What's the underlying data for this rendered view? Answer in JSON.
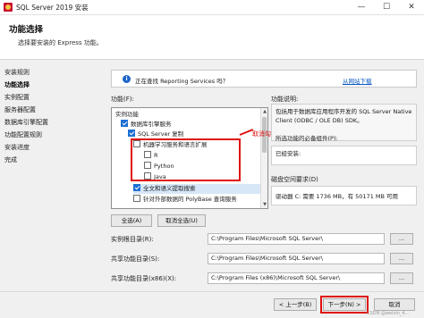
{
  "window": {
    "title": "SQL Server 2019 安装",
    "min_glyph": "—",
    "max_glyph": "☐",
    "close_glyph": "✕"
  },
  "header": {
    "title": "功能选择",
    "subtitle": "选择要安装的 Express 功能。"
  },
  "nav": {
    "items": [
      "安装规则",
      "功能选择",
      "实例配置",
      "服务器配置",
      "数据库引擎配置",
      "功能配置规则",
      "安装进度",
      "完成"
    ],
    "active_index": 1
  },
  "info": {
    "text": "正在查找 Reporting Services 吗？",
    "link": "从网站下载"
  },
  "features": {
    "label": "功能(F):",
    "items": [
      {
        "label": "实例功能",
        "level": 0,
        "checkbox": false,
        "checked": false
      },
      {
        "label": "数据库引擎服务",
        "level": 1,
        "checkbox": true,
        "checked": true
      },
      {
        "label": "SQL Server 复制",
        "level": 2,
        "checkbox": true,
        "checked": true
      },
      {
        "label": "机器学习服务和语言扩展",
        "level": 2,
        "checkbox": true,
        "checked": false
      },
      {
        "label": "R",
        "level": 3,
        "checkbox": true,
        "checked": false
      },
      {
        "label": "Python",
        "level": 3,
        "checkbox": true,
        "checked": false
      },
      {
        "label": "Java",
        "level": 3,
        "checkbox": true,
        "checked": false
      },
      {
        "label": "全文和语义提取搜索",
        "level": 2,
        "checkbox": true,
        "checked": true
      },
      {
        "label": "针对外部数据的 PolyBase 查询服务",
        "level": 2,
        "checkbox": true,
        "checked": false
      }
    ]
  },
  "annotation": {
    "cancel_note": "取消勾选"
  },
  "description": {
    "label": "功能说明:",
    "text": "包括用于数据库应用程序开发的 SQL Server Native Client (ODBC / OLE DB) SDK。",
    "prereq_label": "所选功能的必备组件(P):",
    "installed": "已经安装:",
    "disk_label": "磁盘空间要求(D)",
    "disk_text": "驱动器 C: 需要 1736 MB，有 50171 MB 可用"
  },
  "buttons": {
    "select_all": "全选(A)",
    "deselect_all": "取消全选(U)",
    "back": "< 上一步(B)",
    "next": "下一步(N) >",
    "cancel": "取消",
    "browse": "..."
  },
  "paths": {
    "instance_root_label": "实例根目录(R):",
    "instance_root": "C:\\Program Files\\Microsoft SQL Server\\",
    "shared_label": "共享功能目录(S):",
    "shared": "C:\\Program Files\\Microsoft SQL Server\\",
    "shared_x86_label": "共享功能目录(x86)(X):",
    "shared_x86": "C:\\Program Files (x86)\\Microsoft SQL Server\\"
  },
  "watermark": "CSDN @weixin_4..."
}
